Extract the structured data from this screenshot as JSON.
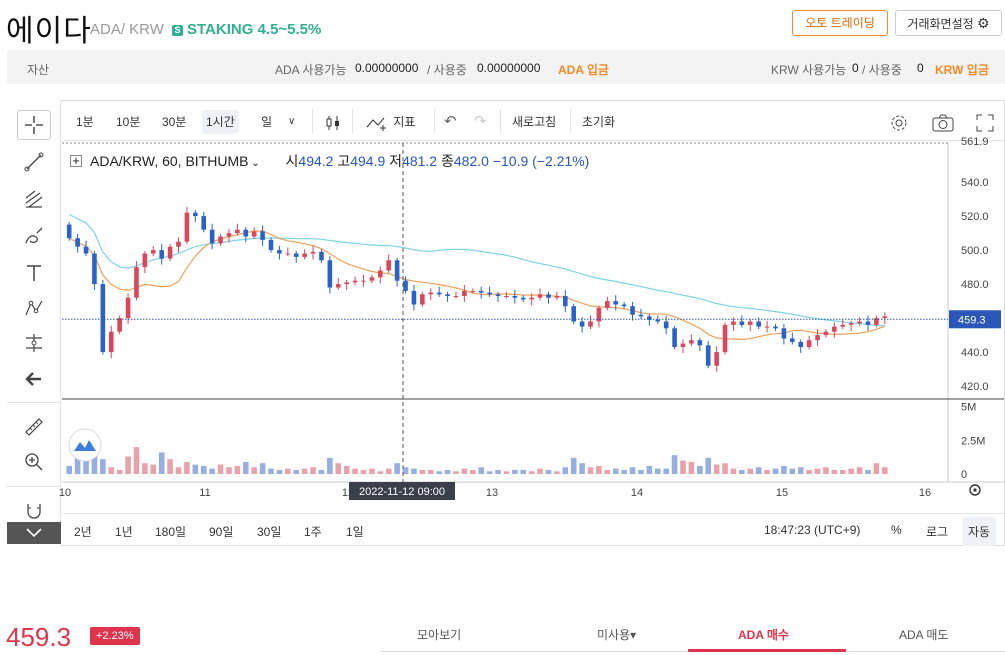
{
  "header": {
    "coin_name": "에이다",
    "pair": "ADA/ KRW",
    "staking": "STAKING 4.5~5.5%",
    "staking_badge": "S",
    "auto_trading_label": "오토 트레이딩",
    "screen_settings_label": "거래화면설정"
  },
  "assets": {
    "label": "자산",
    "ada_available_label": "ADA 사용가능",
    "ada_available_value": "0.00000000",
    "ada_in_use_label": "/ 사용중",
    "ada_in_use_value": "0.00000000",
    "ada_deposit_label": "ADA 입금",
    "krw_available_label": "KRW 사용가능",
    "krw_available_value": "0",
    "krw_in_use_label": "/ 사용중",
    "krw_in_use_value": "0",
    "krw_deposit_label": "KRW 입금"
  },
  "toolbar": {
    "intervals": [
      "1분",
      "10분",
      "30분",
      "1시간",
      "일"
    ],
    "selected_interval": "1시간",
    "indicator_label": "지표",
    "refresh_label": "새로고침",
    "reset_label": "초기화"
  },
  "legend": {
    "symbol": "ADA/KRW, 60, BITHUMB",
    "open_label": "시",
    "open": "494.2",
    "high_label": "고",
    "high": "494.9",
    "low_label": "저",
    "low": "481.2",
    "close_label": "종",
    "close": "482.0",
    "change": "−10.9 (−2.21%)"
  },
  "crosshair_label": "2022-11-12   09:00",
  "range_buttons": [
    "2년",
    "1년",
    "180일",
    "90일",
    "30일",
    "1주",
    "1일"
  ],
  "bottom_right": {
    "time": "18:47:23 (UTC+9)",
    "percent": "%",
    "log": "로그",
    "auto": "자동"
  },
  "price_panel": {
    "price": "459.3",
    "change_pct": "+2.23%"
  },
  "bottom_tabs": [
    "모아보기",
    "미사용▾",
    "ADA 매수",
    "ADA 매도"
  ],
  "colors": {
    "up": "#d9475b",
    "down": "#2a62c9",
    "ma_short": "#f0a058",
    "ma_long": "#7fd4e2",
    "accent": "#f08b25",
    "staking": "#2fb091"
  },
  "chart_data": {
    "type": "candlestick",
    "x_ticks": [
      "10",
      "11",
      "12",
      "13",
      "14",
      "15",
      "16"
    ],
    "y_ticks": [
      540.0,
      520.0,
      500.0,
      480.0,
      460.0,
      440.0,
      420.0
    ],
    "y_top_label": "561.9",
    "ylim": [
      413,
      563
    ],
    "last_price": 459.3,
    "volume_ticks": [
      "5M",
      "2.5M",
      "0"
    ],
    "volume_ylim": [
      0,
      5.5
    ],
    "close": [
      507,
      502,
      498,
      480,
      440,
      452,
      460,
      472,
      490,
      498,
      500,
      495,
      502,
      505,
      522,
      520,
      512,
      504,
      508,
      510,
      512,
      508,
      511,
      506,
      500,
      498,
      498,
      496,
      498,
      499,
      494,
      478,
      480,
      481,
      482,
      482,
      484,
      488,
      494,
      482,
      476,
      468,
      474,
      475,
      474,
      473,
      473,
      476,
      476,
      475,
      474,
      473,
      473,
      472,
      471,
      472,
      474,
      472,
      473,
      467,
      458,
      455,
      458,
      466,
      470,
      468,
      467,
      462,
      461,
      459,
      458,
      454,
      443,
      445,
      447,
      444,
      432,
      440,
      456,
      458,
      456,
      458,
      455,
      455,
      454,
      448,
      446,
      443,
      447,
      450,
      452,
      455,
      456,
      457,
      458,
      456,
      460,
      461
    ],
    "volume": [
      0.6,
      1.6,
      2.8,
      2.3,
      1.1,
      0.5,
      0.3,
      1.3,
      2.0,
      0.8,
      0.7,
      1.6,
      1.1,
      0.5,
      0.9,
      0.7,
      0.6,
      0.4,
      0.7,
      0.5,
      0.6,
      0.9,
      0.5,
      0.8,
      0.4,
      0.3,
      0.4,
      0.3,
      0.4,
      0.5,
      0.3,
      1.2,
      0.8,
      0.6,
      0.4,
      0.3,
      0.4,
      0.2,
      0.4,
      0.8,
      0.5,
      0.4,
      0.3,
      0.3,
      0.2,
      0.3,
      0.2,
      0.4,
      0.3,
      0.5,
      0.2,
      0.3,
      0.2,
      0.3,
      0.3,
      0.2,
      0.4,
      0.3,
      0.2,
      0.5,
      1.2,
      0.8,
      0.5,
      0.6,
      0.3,
      0.4,
      0.3,
      0.5,
      0.3,
      0.6,
      0.4,
      0.4,
      1.4,
      1.0,
      0.9,
      0.6,
      1.2,
      0.7,
      0.8,
      0.4,
      0.3,
      0.4,
      0.5,
      0.3,
      0.4,
      0.6,
      0.4,
      0.5,
      0.3,
      0.4,
      0.5,
      0.3,
      0.3,
      0.4,
      0.5,
      0.3,
      0.8,
      0.5
    ],
    "series": [
      {
        "name": "MA short",
        "color": "#f0a058"
      },
      {
        "name": "MA long",
        "color": "#7fd4e2"
      }
    ]
  }
}
